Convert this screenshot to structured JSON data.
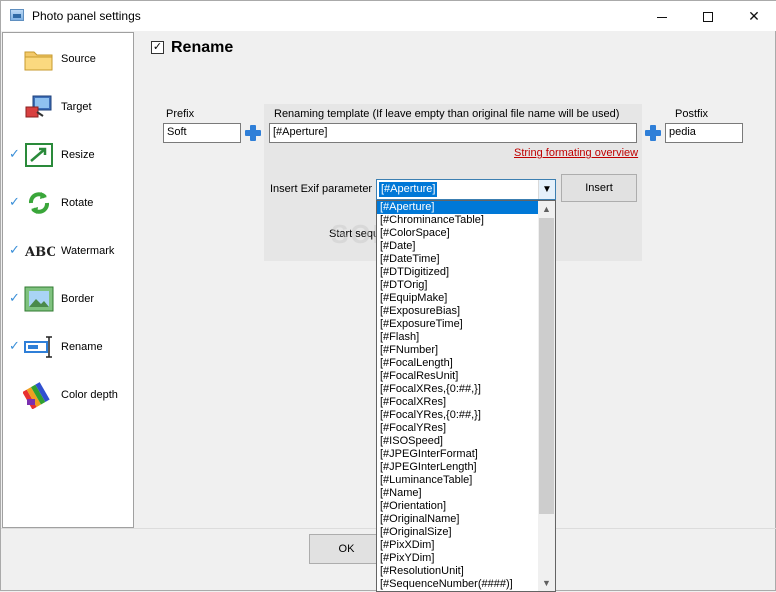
{
  "window": {
    "title": "Photo panel settings",
    "controls": [
      "minimize",
      "maximize",
      "close"
    ],
    "close_glyph": "✕"
  },
  "sidebar": {
    "items": [
      {
        "label": "Source",
        "checked": false,
        "icon": "folder-icon"
      },
      {
        "label": "Target",
        "checked": false,
        "icon": "target-icon"
      },
      {
        "label": "Resize",
        "checked": true,
        "icon": "resize-icon"
      },
      {
        "label": "Rotate",
        "checked": true,
        "icon": "rotate-icon"
      },
      {
        "label": "Watermark",
        "checked": true,
        "icon": "watermark-icon"
      },
      {
        "label": "Border",
        "checked": true,
        "icon": "border-icon"
      },
      {
        "label": "Rename",
        "checked": true,
        "icon": "rename-icon"
      },
      {
        "label": "Color depth",
        "checked": false,
        "icon": "color-depth-icon"
      }
    ]
  },
  "main": {
    "section_title": "Rename",
    "section_checked": true,
    "prefix": {
      "label": "Prefix",
      "value": "Soft"
    },
    "template": {
      "label": "Renaming template (If leave empty than original file name will be used)",
      "value": "[#Aperture]",
      "format_link": "String formating overview"
    },
    "postfix": {
      "label": "Postfix",
      "value": "pedia"
    },
    "exif": {
      "label": "Insert Exif parameter",
      "selected": "[#Aperture]",
      "insert_button": "Insert"
    },
    "start_sequence_label": "Start sequ",
    "ok_button": "OK",
    "watermark_text": "SOFTPEDIA"
  },
  "dropdown": {
    "options": [
      "[#Aperture]",
      "[#ChrominanceTable]",
      "[#ColorSpace]",
      "[#Date]",
      "[#DateTime]",
      "[#DTDigitized]",
      "[#DTOrig]",
      "[#EquipMake]",
      "[#ExposureBias]",
      "[#ExposureTime]",
      "[#Flash]",
      "[#FNumber]",
      "[#FocalLength]",
      "[#FocalResUnit]",
      "[#FocalXRes,{0:##,}]",
      "[#FocalXRes]",
      "[#FocalYRes,{0:##,}]",
      "[#FocalYRes]",
      "[#ISOSpeed]",
      "[#JPEGInterFormat]",
      "[#JPEGInterLength]",
      "[#LuminanceTable]",
      "[#Name]",
      "[#Orientation]",
      "[#OriginalName]",
      "[#OriginalSize]",
      "[#PixXDim]",
      "[#PixYDim]",
      "[#ResolutionUnit]",
      "[#SequenceNumber(####)]"
    ],
    "selected_index": 0
  },
  "colors": {
    "accent": "#0078d7",
    "link": "#c00000",
    "check": "#3a8fd8",
    "plus": "#2f7fd8"
  }
}
